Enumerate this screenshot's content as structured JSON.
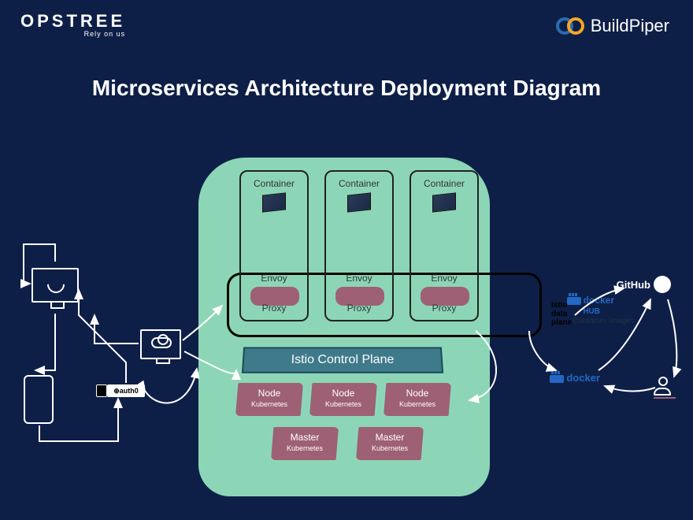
{
  "logos": {
    "left_main": "OPSTREE",
    "left_tag": "Rely on us",
    "right": "BuildPiper"
  },
  "title": "Microservices Architecture Deployment Diagram",
  "pod": {
    "container": "Container",
    "envoy": "Envoy",
    "proxy": "Proxy"
  },
  "dataplane_label": "Istio data plane",
  "control_plane": "Istio Control Plane",
  "nodes": {
    "node_label": "Node",
    "master_label": "Master",
    "sublabel": "Kubernetes"
  },
  "left": {
    "auth0": "⊕auth0"
  },
  "right": {
    "github": "GitHub",
    "docker": "docker",
    "hub": "HUB",
    "container_images": "Container Images",
    "docker2": "docker"
  }
}
